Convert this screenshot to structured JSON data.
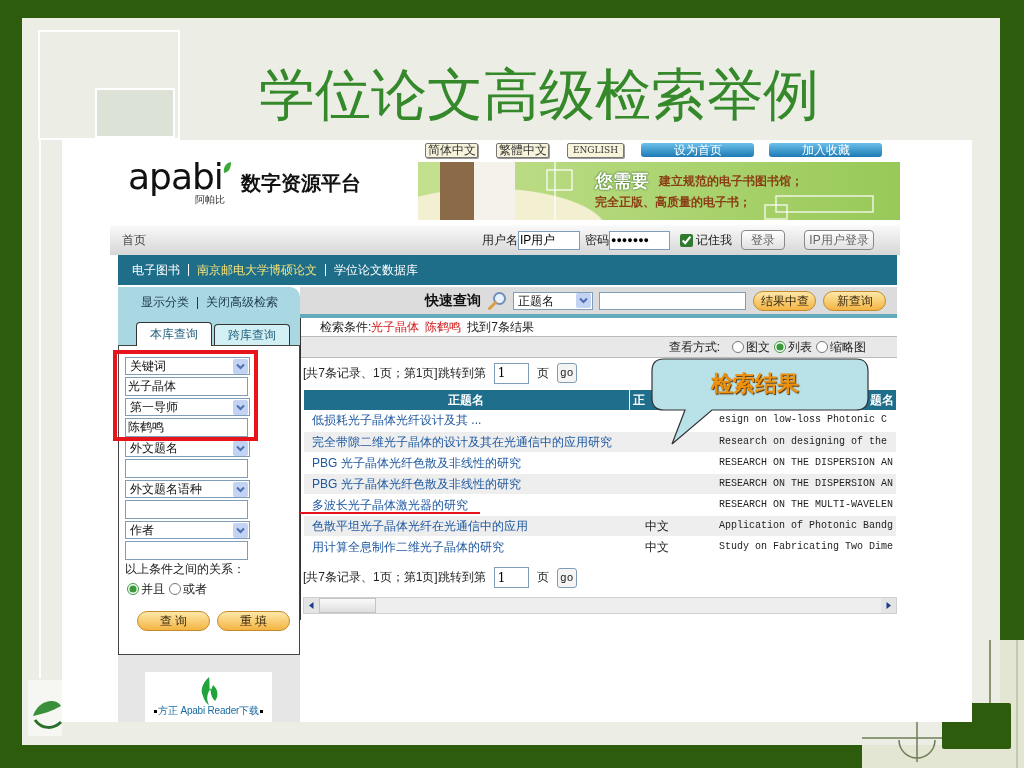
{
  "slide": {
    "title": "学位论文高级检索举例"
  },
  "header": {
    "language_links": [
      "简体中文",
      "繁體中文",
      "ENGLISH"
    ],
    "top_buttons": [
      "设为首页",
      "加入收藏"
    ],
    "logo": {
      "wordmark": "apabi",
      "subtitle": "阿帕比"
    },
    "site_name": "数字资源平台",
    "banner": {
      "headline": "您需要",
      "lines": [
        "建立规范的电子书图书馆；",
        "完全正版、高质量的电子书；"
      ]
    }
  },
  "login_bar": {
    "home_link": "首页",
    "username_label": "用户名",
    "username": "IP用户",
    "password_label": "密码",
    "password": "●●●●●●●",
    "remember_label": "记住我",
    "remember": true,
    "buttons": [
      "登录",
      "IP用户登录"
    ]
  },
  "breadcrumb": [
    {
      "label": "电子图书",
      "current": false
    },
    {
      "label": "南京邮电大学博硕论文",
      "current": true
    },
    {
      "label": "学位论文数据库",
      "current": false
    }
  ],
  "advanced_search": {
    "links": [
      "显示分类",
      "关闭高级检索"
    ],
    "tabs": [
      {
        "label": "本库查询",
        "selected": true
      },
      {
        "label": "跨库查询",
        "selected": false
      }
    ],
    "fields": [
      {
        "field": "关键词",
        "value": "光子晶体",
        "highlighted": true
      },
      {
        "field": "第一导师",
        "value": "陈鹤鸣",
        "highlighted": true
      },
      {
        "field": "外文题名",
        "highlighted": false
      },
      {
        "field": "外文题名语种",
        "highlighted": false
      },
      {
        "field": "作者",
        "highlighted": false
      }
    ],
    "relation_label": "以上条件之间的关系：",
    "relations": [
      {
        "label": "并且",
        "selected": true
      },
      {
        "label": "或者",
        "selected": false
      }
    ],
    "buttons": [
      "查 询",
      "重 填"
    ]
  },
  "reader_download": {
    "label": "方正 Apabi Reader下载"
  },
  "quick_search": {
    "label": "快速查询",
    "field": "正题名",
    "buttons": [
      "结果中查",
      "新查询"
    ]
  },
  "search_summary": {
    "label": "检索条件:",
    "terms": [
      "光子晶体",
      "陈鹤鸣"
    ],
    "result": "找到7条结果"
  },
  "view_mode": {
    "label": "查看方式:",
    "options": [
      {
        "label": "图文",
        "selected": false
      },
      {
        "label": "列表",
        "selected": true
      },
      {
        "label": "缩略图",
        "selected": false
      }
    ]
  },
  "pager_top": {
    "summary": "[共7条记录、1页；第1页]跳转到第",
    "page": "1",
    "unit": "页",
    "button": "go"
  },
  "table": {
    "columns": [
      "正题名",
      "正",
      "题名"
    ],
    "rows": [
      {
        "title": "低损耗光子晶体光纤设计及其 ...",
        "column_3": "esign on low-loss Photonic C",
        "underlined": false
      },
      {
        "title": "完全带隙二维光子晶体的设计及其在光通信中的应用研究",
        "column_3": "Research on designing of the",
        "underlined": false
      },
      {
        "title": "PBG 光子晶体光纤色散及非线性的研究",
        "column_3": "RESEARCH ON THE DISPERSION AN",
        "underlined": false
      },
      {
        "title": "PBG 光子晶体光纤色散及非线性的研究",
        "column_3": "RESEARCH ON THE DISPERSION AN",
        "underlined": false
      },
      {
        "title": "多波长光子晶体激光器的研究",
        "column_3": "RESEARCH ON THE MULTI-WAVELEN",
        "underlined": true
      },
      {
        "title": "色散平坦光子晶体光纤在光通信中的应用",
        "column_2": "中文",
        "column_3": "Application of Photonic Bandg",
        "underlined": false
      },
      {
        "title": "用计算全息制作二维光子晶体的研究",
        "column_2": "中文",
        "column_3": "Study on Fabricating Two Dime",
        "underlined": false
      }
    ]
  },
  "pager_bottom": {
    "summary": "[共7条记录、1页；第1页]跳转到第",
    "page": "1",
    "unit": "页",
    "button": "go"
  },
  "callout": {
    "text": "检索结果"
  }
}
